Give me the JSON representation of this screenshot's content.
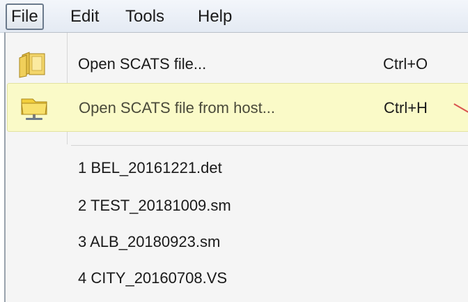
{
  "menubar": {
    "items": [
      {
        "label": "File",
        "active": true
      },
      {
        "label": "Edit",
        "active": false
      },
      {
        "label": "Tools",
        "active": false
      },
      {
        "label": "Help",
        "active": false
      }
    ]
  },
  "file_menu": {
    "actions": [
      {
        "label": "Open SCATS file...",
        "shortcut": "Ctrl+O",
        "icon": "open-folder-icon",
        "highlighted": false
      },
      {
        "label": "Open SCATS file from host...",
        "shortcut": "Ctrl+H",
        "icon": "host-folder-icon",
        "highlighted": true
      }
    ],
    "recent_files": [
      {
        "label": "1 BEL_20161221.det"
      },
      {
        "label": "2 TEST_20181009.sm"
      },
      {
        "label": "3 ALB_20180923.sm"
      },
      {
        "label": "4 CITY_20160708.VS"
      }
    ]
  },
  "colors": {
    "highlight_bg": "#fafac8",
    "menubar_bg": "#e4eaf3",
    "dropdown_bg": "#f5f5f5",
    "annotation": "#d9534f"
  }
}
